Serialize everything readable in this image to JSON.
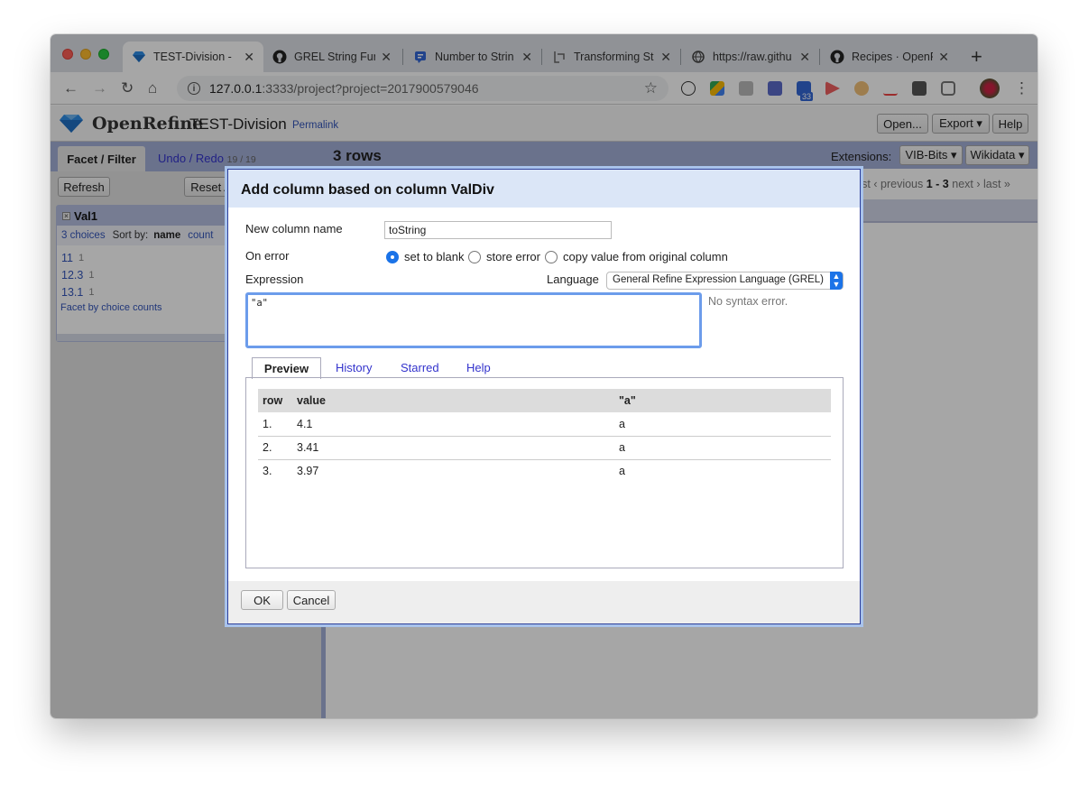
{
  "browser": {
    "tabs": [
      {
        "title": "TEST-Division -",
        "icon": "openrefine-diamond-icon",
        "active": true
      },
      {
        "title": "GREL String Fur",
        "icon": "github-icon"
      },
      {
        "title": "Number to Strin",
        "icon": "chat-icon"
      },
      {
        "title": "Transforming St",
        "icon": "bracket-icon"
      },
      {
        "title": "https://raw.githu",
        "icon": "globe-icon"
      },
      {
        "title": "Recipes · OpenR",
        "icon": "github-icon"
      }
    ],
    "close_glyph": "✕",
    "new_tab_glyph": "+",
    "url_host": "127.0.0.1",
    "url_path": ":3333/project?project=2017900579046",
    "extension_badge": "33"
  },
  "openrefine": {
    "app_name": "OpenRefine",
    "project_name": "TEST-Division",
    "permalink": "Permalink",
    "buttons": {
      "open": "Open...",
      "export": "Export ▾",
      "help": "Help"
    },
    "left": {
      "tab_facet": "Facet / Filter",
      "tab_undo": "Undo / Redo",
      "undo_count": "19 / 19",
      "refresh": "Refresh",
      "reset_all": "Reset A",
      "facet": {
        "title": "Val1",
        "choices": "3 choices",
        "sort_by": "Sort by:",
        "sort_name": "name",
        "sort_count": "count",
        "items": [
          {
            "name": "11",
            "count": "1"
          },
          {
            "name": "12.3",
            "count": "1"
          },
          {
            "name": "13.1",
            "count": "1"
          }
        ],
        "link": "Facet by choice counts"
      }
    },
    "right": {
      "rows": "3 rows",
      "extensions_label": "Extensions:",
      "vib_bits": "VIB-Bits ▾",
      "wikidata": "Wikidata ▾",
      "pager_first": "rst",
      "pager_prev": "‹ previous",
      "pager_range": "1 - 3",
      "pager_next": "next ›",
      "pager_last": "last »"
    }
  },
  "dialog": {
    "title": "Add column based on column ValDiv",
    "new_column_label": "New column name",
    "new_column_value": "toString",
    "on_error_label": "On error",
    "on_error_options": [
      "set to blank",
      "store error",
      "copy value from original column"
    ],
    "on_error_selected": "set to blank",
    "expression_label": "Expression",
    "language_label": "Language",
    "language_value": "General Refine Expression Language (GREL)",
    "expression": "\"a\"",
    "syntax_status": "No syntax error.",
    "tabs": [
      "Preview",
      "History",
      "Starred",
      "Help"
    ],
    "preview": {
      "columns": [
        "row",
        "value",
        "\"a\""
      ],
      "rows": [
        [
          "1.",
          "4.1",
          "a"
        ],
        [
          "2.",
          "3.41",
          "a"
        ],
        [
          "3.",
          "3.97",
          "a"
        ]
      ]
    },
    "ok": "OK",
    "cancel": "Cancel"
  }
}
